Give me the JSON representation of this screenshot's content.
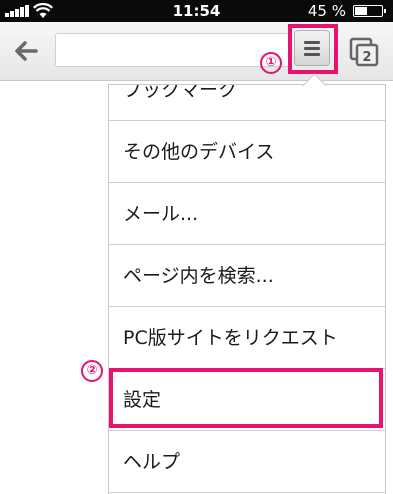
{
  "status_bar": {
    "time": "11:54",
    "battery": "45 %"
  },
  "annotations": {
    "marker_1": "①",
    "marker_2": "②"
  },
  "menu": {
    "items": [
      {
        "label": "ブックマーク"
      },
      {
        "label": "その他のデバイス"
      },
      {
        "label": "メール..."
      },
      {
        "label": "ページ内を検索..."
      },
      {
        "label": "PC版サイトをリクエスト"
      },
      {
        "label": "設定"
      },
      {
        "label": "ヘルプ"
      }
    ]
  },
  "toolbar": {
    "tab_count": "2"
  },
  "colors": {
    "highlight": "#e8136e"
  },
  "icons": [
    "signal-icon",
    "wifi-icon",
    "battery-icon",
    "back-arrow-icon",
    "menu-icon",
    "tabs-icon"
  ]
}
